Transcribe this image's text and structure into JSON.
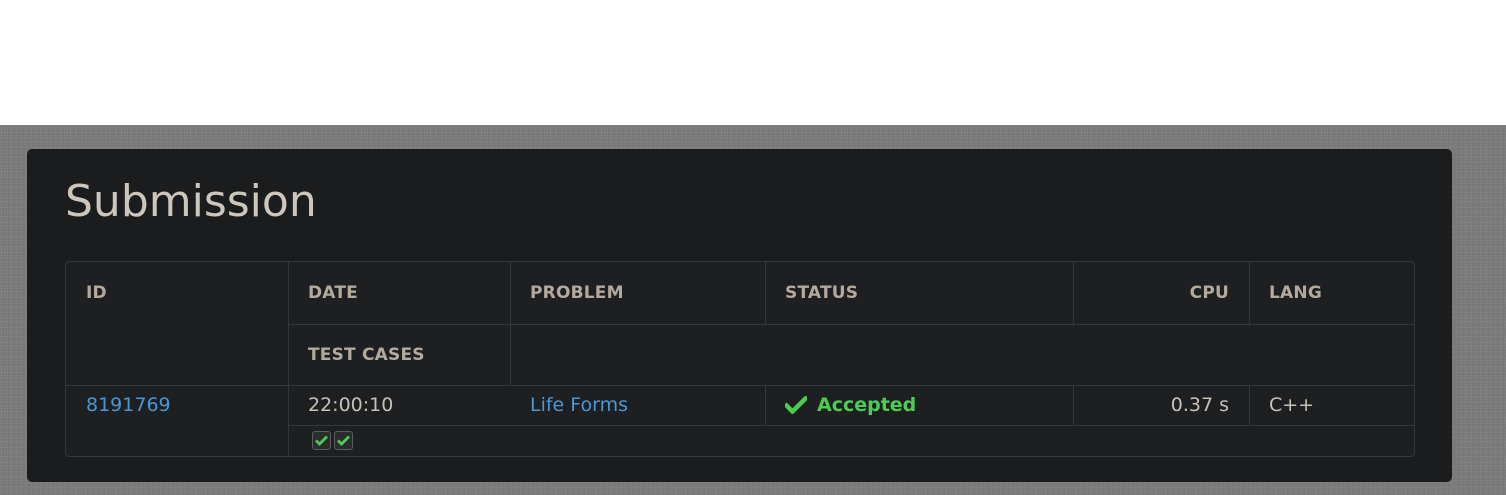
{
  "page": {
    "title": "Submission"
  },
  "table": {
    "headers": {
      "id": "ID",
      "date": "DATE",
      "problem": "PROBLEM",
      "status": "STATUS",
      "cpu": "CPU",
      "lang": "LANG",
      "test_cases": "TEST CASES"
    },
    "rows": [
      {
        "id": "8191769",
        "date": "22:00:10",
        "problem": "Life Forms",
        "status": "Accepted",
        "cpu": "0.37 s",
        "lang": "C++",
        "test_cases": [
          "passed",
          "passed"
        ]
      }
    ]
  },
  "colors": {
    "accepted": "#4bcc52",
    "link": "#4a97d8",
    "card_bg": "#1b1c1e"
  },
  "icons": {
    "status": "check-icon",
    "test_case": "check-icon"
  }
}
